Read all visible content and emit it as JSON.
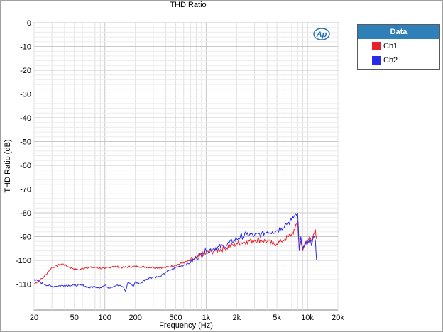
{
  "chart_data": {
    "type": "line",
    "title": "THD Ratio",
    "xlabel": "Frequency (Hz)",
    "ylabel": "THD Ratio (dB)",
    "x_scale": "log",
    "xlim": [
      20,
      20000
    ],
    "ylim": [
      -115,
      0
    ],
    "x_ticks": [
      20,
      50,
      100,
      200,
      500,
      1000,
      2000,
      5000,
      10000,
      20000
    ],
    "x_tick_labels": [
      "20",
      "50",
      "100",
      "200",
      "500",
      "1k",
      "2k",
      "5k",
      "10k",
      "20k"
    ],
    "y_ticks": [
      0,
      -10,
      -20,
      -30,
      -40,
      -50,
      -60,
      -70,
      -80,
      -90,
      -100,
      -110
    ],
    "y_tick_labels": [
      "0",
      "-10",
      "-20",
      "-30",
      "-40",
      "-50",
      "-60",
      "-70",
      "-80",
      "-90",
      "-100",
      "-110"
    ],
    "grid": true,
    "legend": {
      "title": "Data",
      "position": "right"
    },
    "series": [
      {
        "name": "Ch1",
        "color": "#e8202a",
        "points": [
          [
            20,
            -110
          ],
          [
            25,
            -107
          ],
          [
            30,
            -103
          ],
          [
            38,
            -101.5
          ],
          [
            45,
            -103
          ],
          [
            55,
            -104
          ],
          [
            65,
            -103
          ],
          [
            80,
            -103
          ],
          [
            100,
            -103.5
          ],
          [
            120,
            -102.5
          ],
          [
            150,
            -103
          ],
          [
            200,
            -102.5
          ],
          [
            300,
            -103
          ],
          [
            400,
            -103
          ],
          [
            500,
            -102
          ],
          [
            600,
            -101
          ],
          [
            700,
            -100
          ],
          [
            800,
            -99
          ],
          [
            1000,
            -97
          ],
          [
            1200,
            -96
          ],
          [
            1500,
            -95
          ],
          [
            2000,
            -93
          ],
          [
            2500,
            -92
          ],
          [
            3000,
            -91.5
          ],
          [
            3500,
            -91.5
          ],
          [
            4000,
            -92
          ],
          [
            4500,
            -93
          ],
          [
            5000,
            -93
          ],
          [
            5500,
            -92
          ],
          [
            6000,
            -91
          ],
          [
            6500,
            -90
          ],
          [
            7000,
            -89
          ],
          [
            7500,
            -87
          ],
          [
            8000,
            -84
          ],
          [
            8300,
            -95
          ],
          [
            8600,
            -92
          ],
          [
            9000,
            -96
          ],
          [
            9500,
            -92
          ],
          [
            10000,
            -93
          ],
          [
            10500,
            -90
          ],
          [
            11000,
            -92
          ],
          [
            11500,
            -89
          ],
          [
            12000,
            -87
          ],
          [
            12300,
            -91
          ]
        ]
      },
      {
        "name": "Ch2",
        "color": "#2a2ae8",
        "points": [
          [
            20,
            -108
          ],
          [
            25,
            -110
          ],
          [
            30,
            -111
          ],
          [
            40,
            -110.5
          ],
          [
            50,
            -110.5
          ],
          [
            60,
            -110.5
          ],
          [
            70,
            -111.5
          ],
          [
            80,
            -111
          ],
          [
            90,
            -111.5
          ],
          [
            100,
            -110.5
          ],
          [
            110,
            -111.5
          ],
          [
            130,
            -110.5
          ],
          [
            150,
            -111
          ],
          [
            160,
            -113
          ],
          [
            170,
            -109
          ],
          [
            190,
            -111
          ],
          [
            200,
            -109
          ],
          [
            220,
            -110
          ],
          [
            250,
            -108
          ],
          [
            300,
            -107
          ],
          [
            350,
            -107
          ],
          [
            400,
            -105
          ],
          [
            450,
            -104
          ],
          [
            500,
            -103
          ],
          [
            600,
            -102
          ],
          [
            700,
            -101
          ],
          [
            800,
            -99
          ],
          [
            1000,
            -96
          ],
          [
            1200,
            -95
          ],
          [
            1500,
            -94
          ],
          [
            2000,
            -91
          ],
          [
            2500,
            -89
          ],
          [
            3000,
            -89.5
          ],
          [
            3500,
            -89
          ],
          [
            4000,
            -88
          ],
          [
            4500,
            -88
          ],
          [
            5000,
            -87.5
          ],
          [
            5500,
            -86.5
          ],
          [
            6000,
            -85
          ],
          [
            6500,
            -84
          ],
          [
            7000,
            -83
          ],
          [
            7500,
            -81
          ],
          [
            8000,
            -80
          ],
          [
            8300,
            -96
          ],
          [
            8600,
            -90
          ],
          [
            9000,
            -95
          ],
          [
            9500,
            -92
          ],
          [
            10000,
            -93
          ],
          [
            10500,
            -91
          ],
          [
            11000,
            -94
          ],
          [
            11500,
            -90
          ],
          [
            12000,
            -92
          ],
          [
            12300,
            -100
          ]
        ]
      }
    ]
  },
  "logo_text": "Ap"
}
